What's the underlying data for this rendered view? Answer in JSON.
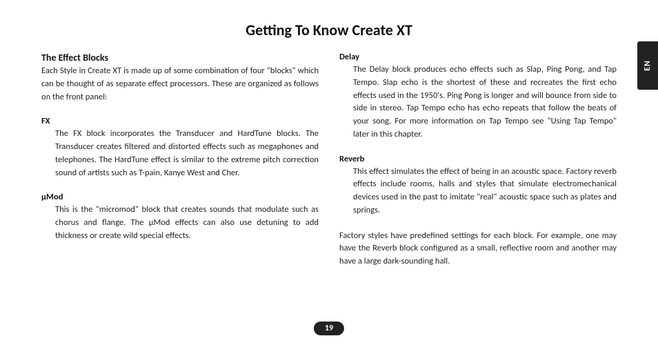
{
  "title": "Getting To Know Create XT",
  "lang_tab": "EN",
  "page_number": "19",
  "left": {
    "section_title": "The Effect Blocks",
    "intro": "Each Style in Create XT is made up of some combination of four \"blocks\" which can be thought of as separate effect processors. These are organized as follows on the front panel:",
    "fx_label": "FX",
    "fx_body": "The FX block incorporates the Transducer and HardTune blocks. The Transducer creates filtered and distorted effects such as megaphones and telephones. The HardTune effect is similar to the extreme pitch correction sound of artists such as T-pain, Kanye West and Cher.",
    "mod_label": "μMod",
    "mod_body": "This is the \"micromod\" block that creates sounds that modulate such as chorus and flange. The μMod effects can also use detuning to add thickness or create wild special effects."
  },
  "right": {
    "delay_label": "Delay",
    "delay_body": "The Delay block produces echo effects such as Slap, Ping Pong, and Tap Tempo. Slap echo is the shortest of these and recreates the first echo effects used in the 1950's. Ping Pong is longer and will bounce from side to side in stereo. Tap Tempo echo has echo repeats that follow the beats of your song. For more information on Tap Tempo see \"Using Tap Tempo\" later in this chapter.",
    "reverb_label": "Reverb",
    "reverb_body": "This effect simulates the effect of being in an acoustic space. Factory reverb effects include rooms, halls and styles that simulate electromechanical devices used in the past to imitate \"real\" acoustic space such as plates and springs.",
    "closing": "Factory styles have predefined settings for each block. For example, one may have the Reverb block configured as a small, reflective room and another may have a large dark-sounding hall."
  }
}
